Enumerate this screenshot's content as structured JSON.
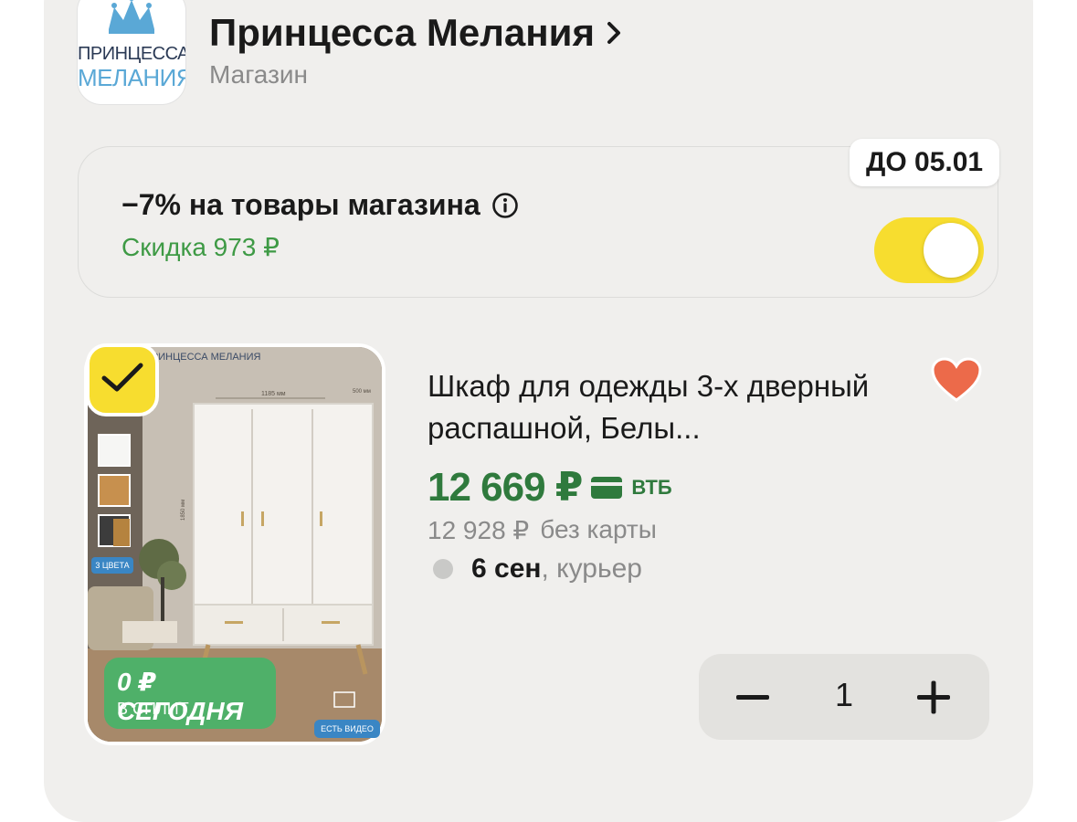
{
  "store": {
    "logo_line1": "ПРИНЦЕССА",
    "logo_line2": "МЕЛАНИЯ",
    "name": "Принцесса Мелания",
    "type": "Магазин"
  },
  "promo": {
    "badge": "ДО 05.01",
    "title": "−7% на товары магазина",
    "subtitle": "Скидка 973 ₽",
    "toggle_on": true
  },
  "product": {
    "image_brand": "ПРИНЦЕССА МЕЛАНИЯ",
    "split_title": "0 ₽ СЕГОДНЯ",
    "split_sub": "В СПЛИТ",
    "colors_tag": "3 ЦВЕТА",
    "video_tag": "ЕСТЬ ВИДЕО",
    "dim_width": "1185 мм",
    "dim_depth": "500 мм",
    "dim_height": "1850 мм",
    "title": "Шкаф для одежды 3-х дверный распашной, Белы...",
    "price": "12 669 ₽",
    "bank": "ВТБ",
    "old_price": "12 928 ₽",
    "old_price_note": "без карты",
    "delivery_date": "6 сен",
    "delivery_method": ", курьер",
    "quantity": "1",
    "selected": true,
    "favorite": true
  },
  "colors": {
    "accent_yellow": "#f7dd2f",
    "price_green": "#2f7a3d",
    "discount_green": "#3e9a45",
    "favorite": "#ec6a4a"
  }
}
